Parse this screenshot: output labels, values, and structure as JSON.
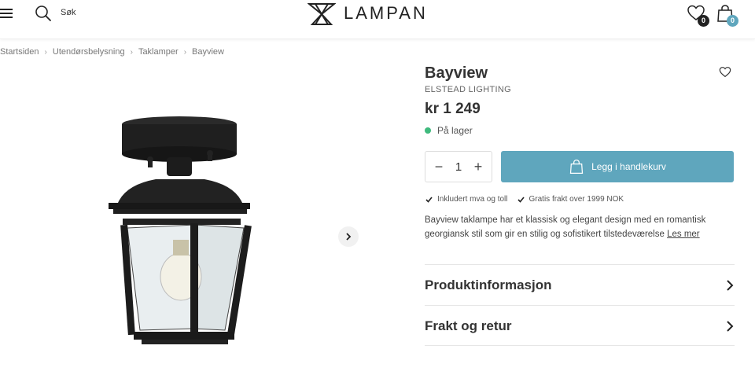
{
  "header": {
    "search_label": "Søk",
    "logo_text": "LAMPAN",
    "wishlist_count": "0",
    "cart_count": "0",
    "wishlist_badge_color": "#222222",
    "cart_badge_color": "#5fa6bd"
  },
  "breadcrumb": [
    "Startsiden",
    "Utendørsbelysning",
    "Taklamper",
    "Bayview"
  ],
  "product": {
    "title": "Bayview",
    "brand": "ELSTEAD LIGHTING",
    "price": "kr 1 249",
    "stock": "På lager",
    "stock_color": "#3fba7d",
    "quantity": "1",
    "add_to_cart": "Legg i handlekurv",
    "usps": [
      "Inkludert mva og toll",
      "Gratis frakt over 1999 NOK"
    ],
    "description": "Bayview taklampe har et klassisk og elegant design med en romantisk georgiansk stil som gir en stilig og sofistikert tilstedeværelse",
    "read_more": "Les mer",
    "accordions": [
      "Produktinformasjon",
      "Frakt og retur"
    ]
  },
  "icons": {
    "menu": "hamburger-icon",
    "search": "search-icon",
    "wishlist": "heart-icon",
    "cart": "bag-icon",
    "next": "chevron-right-icon"
  }
}
